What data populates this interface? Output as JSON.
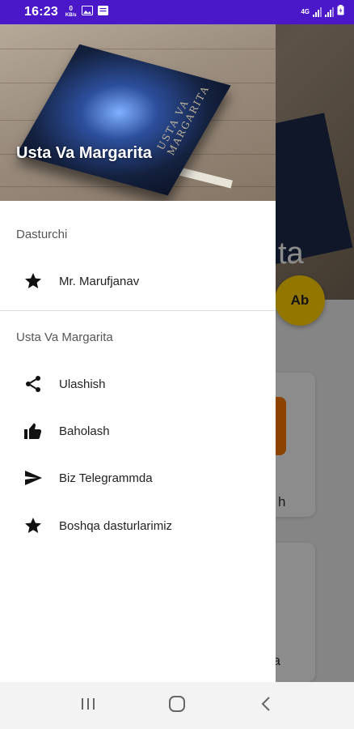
{
  "status_bar": {
    "time": "16:23",
    "notif_zero": "0",
    "notif_kbs": "KB/s",
    "net_4g": "4G"
  },
  "drawer": {
    "header_title": "Usta Va Margarita",
    "book_cover_text": "USTA VA MARGARITA",
    "section1_label": "Dasturchi",
    "developer_item": "Mr. Marufjanav",
    "section2_label": "Usta Va Margarita",
    "items": [
      {
        "label": "Ulashish",
        "icon": "share-icon"
      },
      {
        "label": "Baholash",
        "icon": "thumb-up-icon"
      },
      {
        "label": "Biz Telegrammda",
        "icon": "send-icon"
      },
      {
        "label": "Boshqa dasturlarimiz",
        "icon": "star-icon"
      }
    ]
  },
  "background_app": {
    "title_fragment": "ta",
    "fab_label": "Ab",
    "card1_text": "h",
    "card2_text": "da"
  },
  "colors": {
    "status_bar": "#4a18c8",
    "fab": "#f5c400"
  }
}
